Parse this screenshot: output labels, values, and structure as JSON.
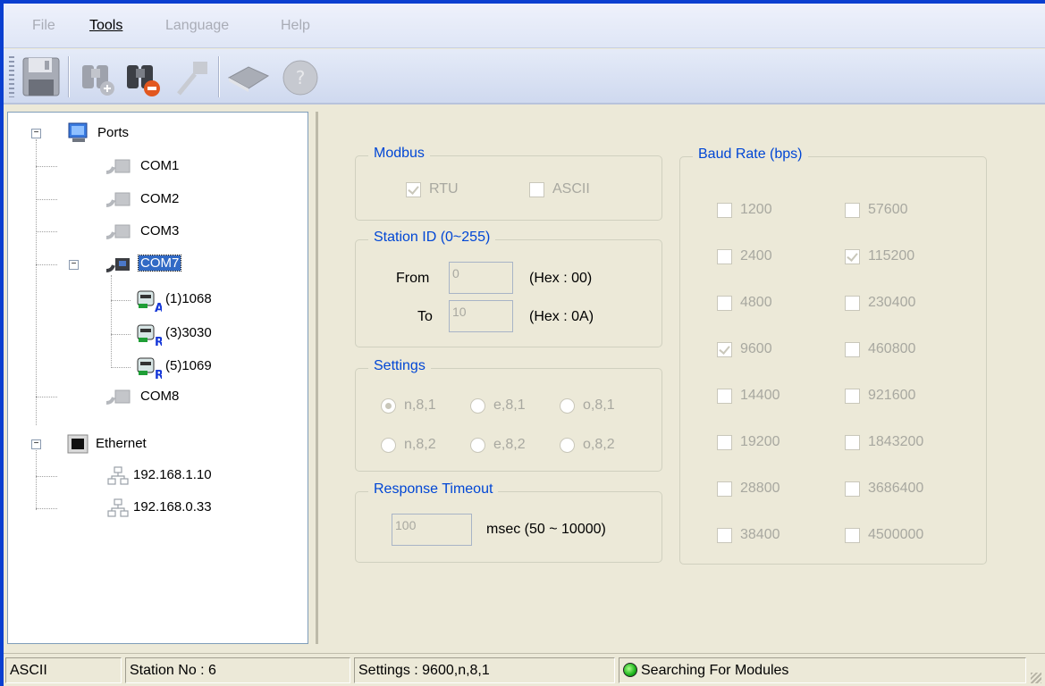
{
  "menu": {
    "file": "File",
    "tools": "Tools",
    "language": "Language",
    "help": "Help"
  },
  "toolbar": {
    "icons": [
      "save-icon",
      "search-add-icon",
      "search-remove-icon",
      "connect-icon",
      "book-icon",
      "help-icon"
    ]
  },
  "tree": {
    "ports": "Ports",
    "com1": "COM1",
    "com2": "COM2",
    "com3": "COM3",
    "com7": "COM7",
    "module1": "(1)1068",
    "module3": "(3)3030",
    "module5": "(5)1069",
    "com8": "COM8",
    "ethernet": "Ethernet",
    "ip1": "192.168.1.10",
    "ip2": "192.168.0.33"
  },
  "modbus": {
    "title": "Modbus",
    "rtu": "RTU",
    "ascii": "ASCII"
  },
  "station": {
    "title": "Station ID (0~255)",
    "from_label": "From",
    "from_value": "0",
    "from_hex": "(Hex : 00)",
    "to_label": "To",
    "to_value": "10",
    "to_hex": "(Hex : 0A)"
  },
  "settings": {
    "title": "Settings",
    "options": [
      "n,8,1",
      "e,8,1",
      "o,8,1",
      "n,8,2",
      "e,8,2",
      "o,8,2"
    ]
  },
  "timeout": {
    "title": "Response Timeout",
    "value": "100",
    "unit": "msec (50 ~ 10000)"
  },
  "baud": {
    "title": "Baud Rate (bps)",
    "left": [
      "1200",
      "2400",
      "4800",
      "9600",
      "14400",
      "19200",
      "28800",
      "38400"
    ],
    "right": [
      "57600",
      "115200",
      "230400",
      "460800",
      "921600",
      "1843200",
      "3686400",
      "4500000"
    ]
  },
  "status": {
    "mode": "ASCII",
    "station": "Station No : 6",
    "settings": "Settings : 9600,n,8,1",
    "search": "Searching For Modules"
  }
}
